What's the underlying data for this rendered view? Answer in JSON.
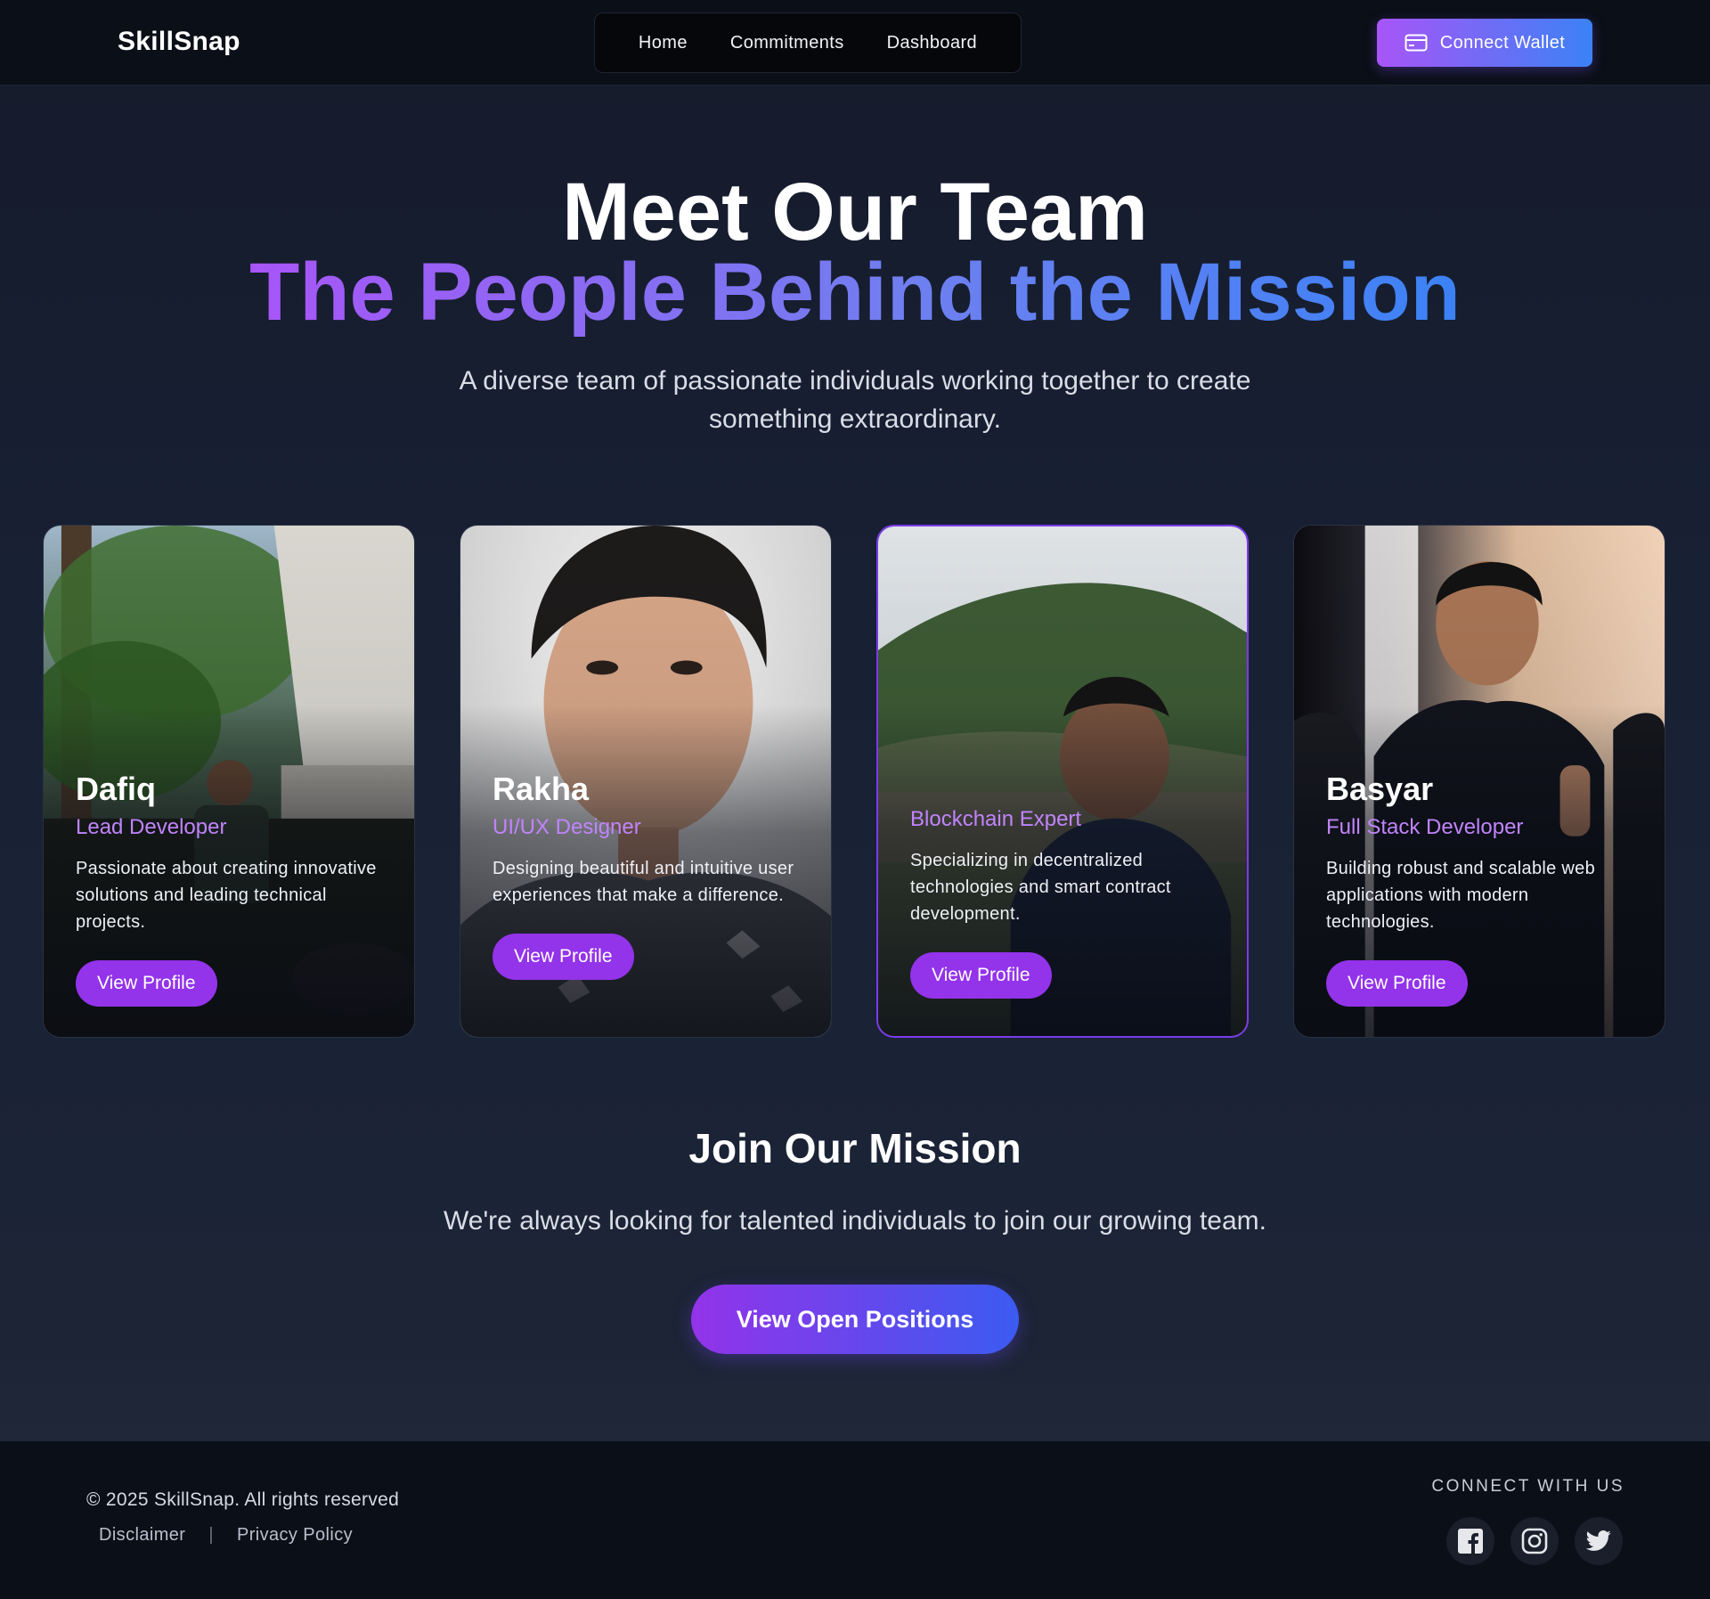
{
  "header": {
    "brand": "SkillSnap",
    "nav": [
      "Home",
      "Commitments",
      "Dashboard"
    ],
    "wallet_label": "Connect Wallet"
  },
  "hero": {
    "title": "Meet Our Team",
    "subtitle": "The People Behind the Mission",
    "description": "A diverse team of passionate individuals working together to create something extraordinary."
  },
  "team": [
    {
      "name": "Dafiq",
      "role": "Lead Developer",
      "bio": "Passionate about creating innovative solutions and leading technical projects.",
      "button": "View Profile"
    },
    {
      "name": "Rakha",
      "role": "UI/UX Designer",
      "bio": "Designing beautiful and intuitive user experiences that make a difference.",
      "button": "View Profile"
    },
    {
      "role": "Blockchain Expert",
      "bio": "Specializing in decentralized technologies and smart contract development.",
      "button": "View Profile"
    },
    {
      "name": "Basyar",
      "role": "Full Stack Developer",
      "bio": "Building robust and scalable web applications with modern technologies.",
      "button": "View Profile"
    }
  ],
  "join": {
    "title": "Join Our Mission",
    "description": "We're always looking for talented individuals to join our growing team.",
    "button": "View Open Positions"
  },
  "footer": {
    "copyright": "© 2025 SkillSnap. All rights reserved",
    "links": [
      "Disclaimer",
      "Privacy Policy"
    ],
    "separator": "|",
    "connect_label": "CONNECT WITH US",
    "socials": [
      "facebook-icon",
      "instagram-icon",
      "twitter-icon"
    ]
  },
  "colors": {
    "accent_purple": "#a855f7",
    "accent_blue": "#3b82f6",
    "button_purple": "#9333ea",
    "role_text": "#c084fc"
  }
}
